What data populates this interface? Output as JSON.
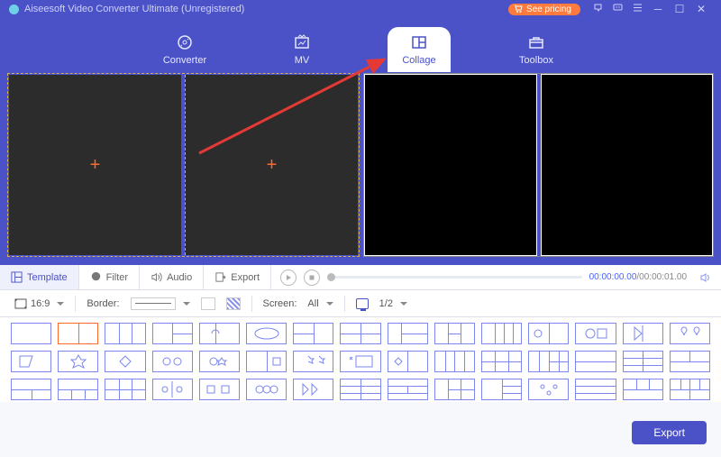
{
  "title": "Aiseesoft Video Converter Ultimate (Unregistered)",
  "pricing_label": "See pricing",
  "nav": {
    "converter": "Converter",
    "mv": "MV",
    "collage": "Collage",
    "toolbox": "Toolbox"
  },
  "tabs": {
    "template": "Template",
    "filter": "Filter",
    "audio": "Audio",
    "export": "Export"
  },
  "playback": {
    "current": "00:00:00.00",
    "total": "00:00:01.00"
  },
  "options": {
    "aspect_icon": "aspect-icon",
    "aspect": "16:9",
    "border_label": "Border:",
    "screen_label": "Screen:",
    "screen_value": "All",
    "page": "1/2"
  },
  "export_button": "Export"
}
